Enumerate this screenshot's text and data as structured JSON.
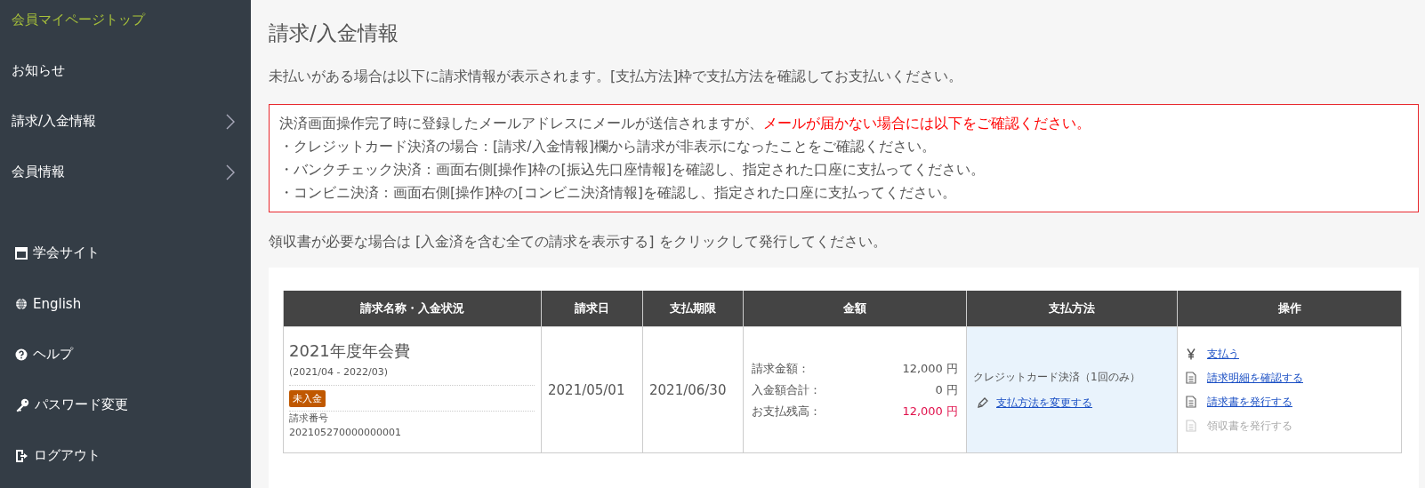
{
  "sidebar": {
    "nav": [
      {
        "label": "会員マイページトップ",
        "selected": true,
        "has_submenu": false
      },
      {
        "label": "お知らせ",
        "selected": false,
        "has_submenu": false
      },
      {
        "label": "請求/入金情報",
        "selected": false,
        "has_submenu": true
      },
      {
        "label": "会員情報",
        "selected": false,
        "has_submenu": true
      }
    ],
    "links": [
      {
        "label": "学会サイト",
        "kind": "site"
      },
      {
        "label": "English",
        "kind": "language"
      },
      {
        "label": "ヘルプ",
        "kind": "help"
      },
      {
        "label": "パスワード変更",
        "kind": "password"
      },
      {
        "label": "ログアウト",
        "kind": "logout"
      }
    ]
  },
  "page_title": "請求/入金情報",
  "intro": "未払いがある場合は以下に請求情報が表示されます。[支払方法]枠で支払方法を確認してお支払いください。",
  "notice": {
    "lead": "決済画面操作完了時に登録したメールアドレスにメールが送信されますが、",
    "warning": "メールが届かない場合には以下をご確認ください。",
    "lines": [
      "・クレジットカード決済の場合：[請求/入金情報]欄から請求が非表示になったことをご確認ください。",
      "・バンクチェック決済：画面右側[操作]枠の[振込先口座情報]を確認し、指定された口座に支払ってください。",
      "・コンビニ決済：画面右側[操作]枠の[コンビニ決済情報]を確認し、指定された口座に支払ってください。"
    ]
  },
  "receipt_note": "領収書が必要な場合は [入金済を含む全ての請求を表示する] をクリックして発行してください。",
  "table": {
    "columns": [
      "請求名称・入金状況",
      "請求日",
      "支払期限",
      "金額",
      "支払方法",
      "操作"
    ],
    "rows": [
      {
        "name": "2021年度年会費",
        "period": "(2021/04 - 2022/03)",
        "status": "未入金",
        "number_label": "請求番号",
        "number": "202105270000000001",
        "billed_date": "2021/05/01",
        "due_date": "2021/06/30",
        "amounts": [
          {
            "label": "請求金額：",
            "value": "12,000 円",
            "emphasis": false
          },
          {
            "label": "入金額合計：",
            "value": "0 円",
            "emphasis": false
          },
          {
            "label": "お支払残高：",
            "value": "12,000 円",
            "emphasis": true
          }
        ],
        "payment_method": "クレジットカード決済（1回のみ）",
        "change_method_link": "支払方法を変更する",
        "actions": [
          {
            "label": "支払う",
            "kind": "pay",
            "disabled": false
          },
          {
            "label": "請求明細を確認する",
            "kind": "document",
            "disabled": false
          },
          {
            "label": "請求書を発行する",
            "kind": "document",
            "disabled": false
          },
          {
            "label": "領収書を発行する",
            "kind": "document",
            "disabled": true
          }
        ]
      }
    ]
  }
}
